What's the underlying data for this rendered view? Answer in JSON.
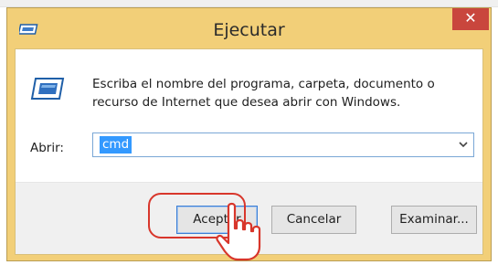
{
  "window": {
    "title": "Ejecutar",
    "close_symbol": "✕"
  },
  "dialog": {
    "description_line1": "Escriba el nombre del programa, carpeta, documento o",
    "description_line2": "recurso de Internet que desea abrir con Windows.",
    "open_label": "Abrir:",
    "open_value": "cmd"
  },
  "buttons": {
    "ok": "Aceptar",
    "cancel": "Cancelar",
    "browse": "Examinar..."
  },
  "icons": {
    "title": "run-window-icon",
    "body": "run-dialog-icon",
    "dropdown": "chevron-down-icon",
    "cursor": "hand-pointer-icon"
  },
  "colors": {
    "titlebar": "#f2cf78",
    "close": "#c9463d",
    "selection": "#3399ff",
    "annotation": "#d8362b"
  }
}
